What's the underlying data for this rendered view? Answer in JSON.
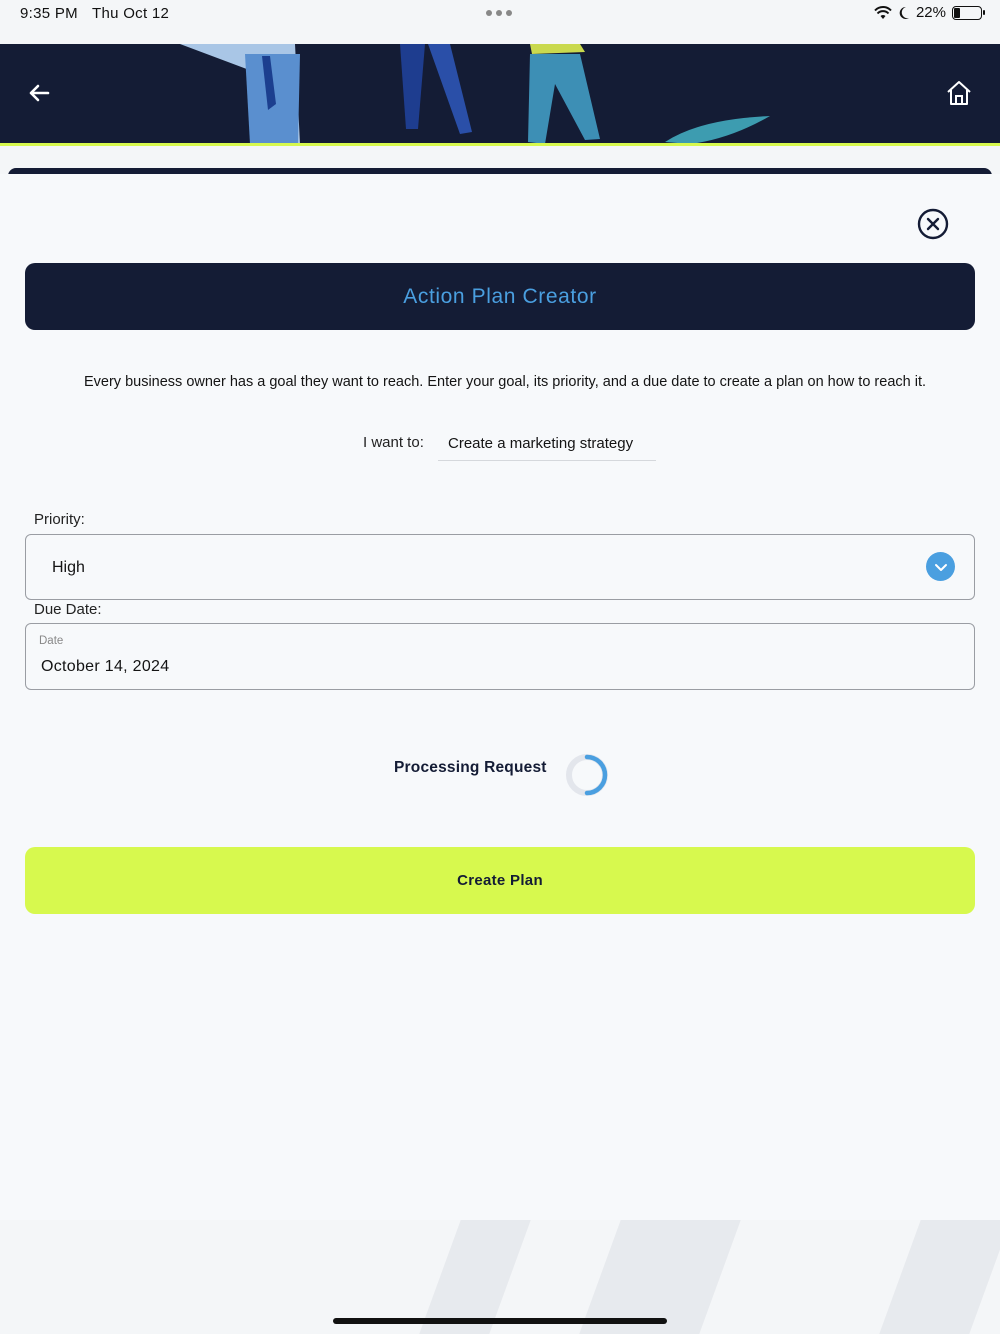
{
  "status_bar": {
    "time": "9:35 PM",
    "date": "Thu Oct 12",
    "battery": "22%",
    "battery_level": 0.22,
    "icons": [
      "wifi-icon",
      "moon-icon",
      "battery-icon"
    ]
  },
  "header": {
    "back_icon": "arrow-left-icon",
    "home_icon": "home-icon"
  },
  "dialog": {
    "close_icon": "close-circle-icon",
    "title": "Action Plan Creator",
    "description": "Every business owner has a goal they want to reach. Enter your goal, its priority, and a due date to create a plan on how to reach it.",
    "goal": {
      "label": "I want to:",
      "value": "Create a marketing strategy"
    },
    "priority": {
      "label": "Priority:",
      "value": "High",
      "icon": "chevron-down-icon"
    },
    "due_date": {
      "label": "Due Date:",
      "caption": "Date",
      "value": "October 14, 2024"
    },
    "processing": {
      "text": "Processing Request"
    },
    "create_button": "Create Plan"
  },
  "colors": {
    "navy": "#141c35",
    "accent_blue": "#4a9fe0",
    "lime": "#d7f94e",
    "background": "#f7f9fb"
  }
}
